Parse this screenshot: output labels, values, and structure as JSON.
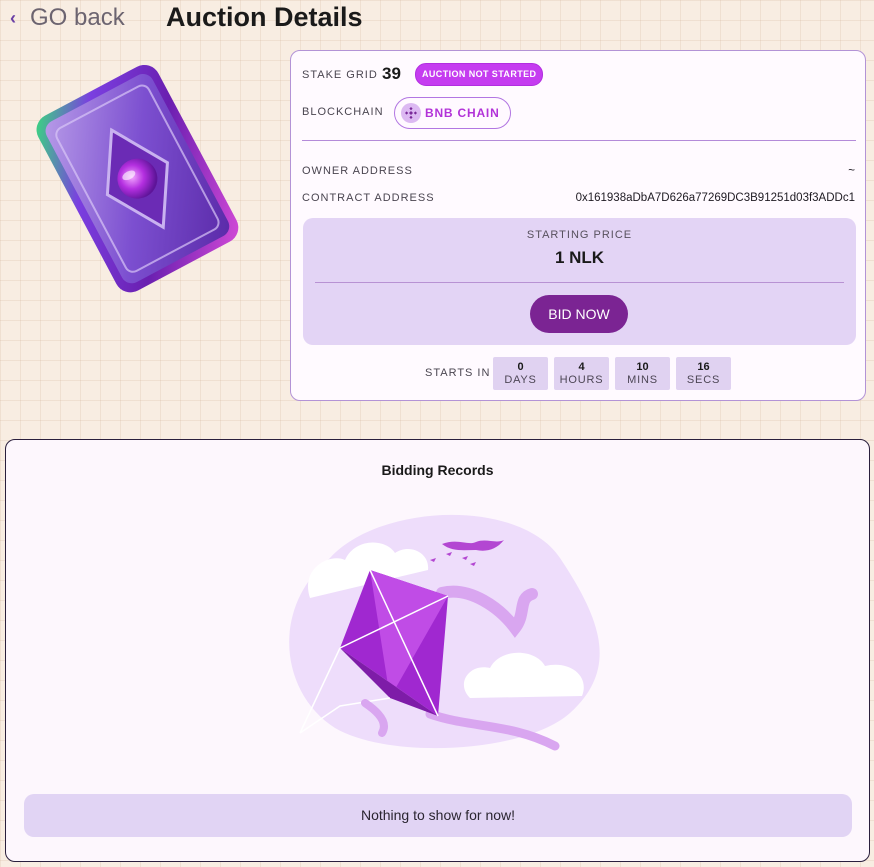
{
  "header": {
    "back_label": "GO back",
    "title": "Auction Details"
  },
  "auction": {
    "stake_grid_label": "STAKE GRID",
    "stake_grid_value": "39",
    "status_badge": "AUCTION NOT STARTED",
    "blockchain_label": "BLOCKCHAIN",
    "blockchain_value": "BNB CHAIN",
    "owner_label": "OWNER ADDRESS",
    "owner_value": "~",
    "contract_label": "CONTRACT ADDRESS",
    "contract_value": "0x161938aDbA7D626a77269DC3B91251d03f3ADDc1",
    "starting_price_label": "STARTING PRICE",
    "starting_price_value": "1 NLK",
    "bid_button": "BID NOW",
    "starts_in_label": "STARTS IN",
    "countdown": [
      {
        "value": "0",
        "unit": "DAYS"
      },
      {
        "value": "4",
        "unit": "HOURS"
      },
      {
        "value": "10",
        "unit": "MINS"
      },
      {
        "value": "16",
        "unit": "SECS"
      }
    ]
  },
  "records": {
    "title": "Bidding Records",
    "empty_message": "Nothing to show for now!"
  },
  "colors": {
    "accent": "#7b2493",
    "badge": "#c53cf0",
    "panel": "#e3d4f5",
    "background": "#f8ede2"
  }
}
